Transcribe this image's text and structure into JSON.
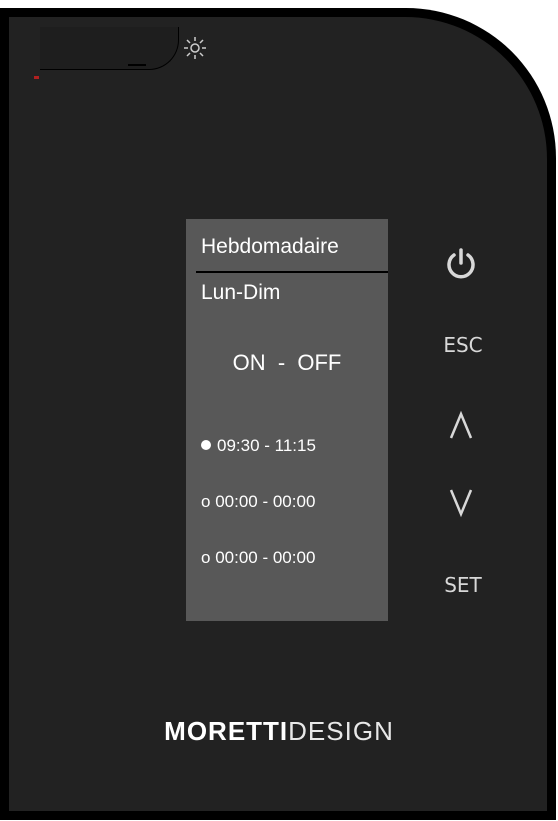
{
  "screen": {
    "title": "Hebdomadaire",
    "days": "Lun-Dim",
    "mode": "ON  -  OFF",
    "slots": [
      {
        "marker": "filled",
        "text": "09:30 - 11:15"
      },
      {
        "marker": "o",
        "text": "00:00 - 00:00"
      },
      {
        "marker": "o",
        "text": "00:00 - 00:00"
      }
    ]
  },
  "buttons": {
    "esc_label": "ESC",
    "set_label": "SET",
    "power_icon": "power-icon",
    "up_icon": "chevron-up-icon",
    "down_icon": "chevron-down-icon"
  },
  "brand": {
    "bold": "MORETTI",
    "light": "DESIGN"
  },
  "colors": {
    "body": "#222222",
    "screen": "#585858",
    "text": "#ffffff"
  }
}
